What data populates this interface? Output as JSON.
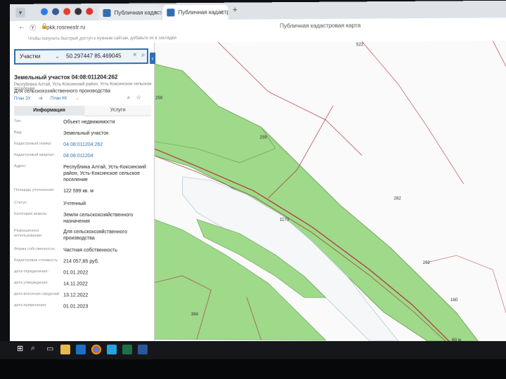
{
  "browser": {
    "tabs": [
      {
        "label": "Публичная кадастровая",
        "active": false
      },
      {
        "label": "Публичная кадастровая",
        "active": true
      }
    ],
    "url": "pkk.rosreestr.ru",
    "page_title": "Публичная кадастровая карта",
    "bookmarks_text": "Чтобы получить быстрый доступ к нужным сайтам, добавьте их в закладки"
  },
  "search": {
    "category": "Участки",
    "query": "50.297447 85.469045"
  },
  "object": {
    "title": "Земельный участок 04:08:011204:262",
    "address_short": "Республика Алтай, Усть-Коксинский район, Усть-Коксинское сельское поселение",
    "purpose": "Для сельскохозяйственного производства",
    "plan_zu": "План ЗУ",
    "plan_kk": "План КК"
  },
  "tabs": {
    "info": "Информация",
    "services": "Услуги"
  },
  "fields": [
    {
      "label": "Тип:",
      "value": "Объект недвижимости",
      "link": false
    },
    {
      "label": "Вид:",
      "value": "Земельный участок",
      "link": false
    },
    {
      "label": "Кадастровый номер:",
      "value": "04:08:011204:262",
      "link": true
    },
    {
      "label": "Кадастровый квартал:",
      "value": "04:08:011204",
      "link": true
    },
    {
      "label": "Адрес:",
      "value": "Республика Алтай, Усть-Коксинский район, Усть-Коксинское сельское поселение",
      "link": false
    },
    {
      "label": "Площадь уточненная:",
      "value": "122 599 кв. м",
      "link": false
    },
    {
      "label": "Статус:",
      "value": "Учтенный",
      "link": false
    },
    {
      "label": "Категория земель:",
      "value": "Земли сельскохозяйственного назначения",
      "link": false
    },
    {
      "label": "Разрешенное использование:",
      "value": "Для сельскохозяйственного производства",
      "link": false
    },
    {
      "label": "Форма собственности:",
      "value": "Частная собственность",
      "link": false
    },
    {
      "label": "Кадастровая стоимость:",
      "value": "214 057,85 руб.",
      "link": false
    },
    {
      "label": "дата определения:",
      "value": "01.01.2022",
      "link": false
    },
    {
      "label": "дата утверждения:",
      "value": "14.11.2022",
      "link": false
    },
    {
      "label": "дата внесения сведений:",
      "value": "13.12.2022",
      "link": false
    },
    {
      "label": "дата применения:",
      "value": "01.01.2023",
      "link": false
    }
  ],
  "map": {
    "labels": [
      {
        "text": "522"
      },
      {
        "text": "259"
      },
      {
        "text": "259"
      },
      {
        "text": "262"
      },
      {
        "text": "262"
      },
      {
        "text": "160"
      },
      {
        "text": "394"
      },
      {
        "text": "1173"
      }
    ],
    "scale": "60 м"
  },
  "colors": {
    "accent": "#2f6fb5",
    "parcel_fill": "#9fd98a",
    "boundary": "#b03040"
  },
  "taskbar": {
    "icons": [
      "windows-start-icon",
      "search-icon",
      "task-view-icon",
      "file-explorer-icon",
      "outlook-icon",
      "chrome-icon",
      "yandex-icon",
      "excel-icon",
      "word-icon"
    ]
  }
}
